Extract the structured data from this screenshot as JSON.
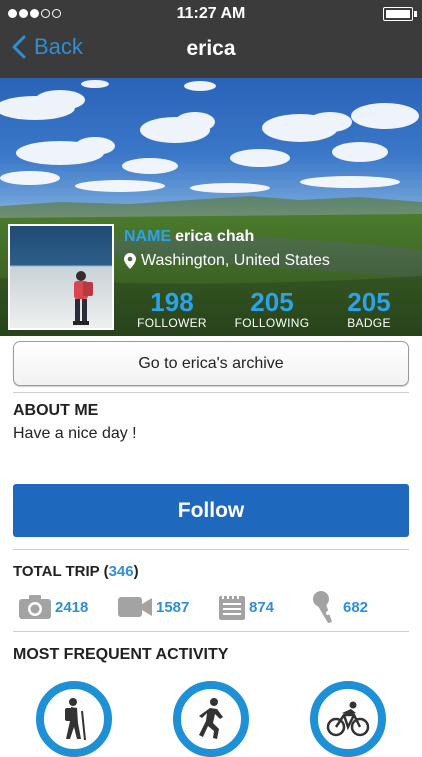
{
  "status": {
    "time": "11:27 AM"
  },
  "nav": {
    "back_label": "Back",
    "title": "erica"
  },
  "profile": {
    "name_tag": "NAME",
    "name": "erica chah",
    "location": "Washington, United States",
    "stats": [
      {
        "value": "198",
        "label": "FOLLOWER"
      },
      {
        "value": "205",
        "label": "FOLLOWING"
      },
      {
        "value": "205",
        "label": "BADGE"
      }
    ]
  },
  "archive_button": "Go to erica's archive",
  "about": {
    "title": "ABOUT ME",
    "text": "Have a nice day !"
  },
  "follow_button": "Follow",
  "trips": {
    "title": "TOTAL TRIP (",
    "count": "346",
    "close": ")",
    "media": [
      {
        "icon": "camera-icon",
        "value": "2418"
      },
      {
        "icon": "video-icon",
        "value": "1587"
      },
      {
        "icon": "notebook-icon",
        "value": "874"
      },
      {
        "icon": "microphone-icon",
        "value": "682"
      }
    ]
  },
  "activity": {
    "title": "MOST FREQUENT ACTIVITY",
    "items": [
      "hiking-icon",
      "running-icon",
      "cycling-icon"
    ]
  },
  "colors": {
    "accent": "#2e8fd4",
    "follow": "#1e68bd",
    "topbar": "#3b3b3b"
  }
}
